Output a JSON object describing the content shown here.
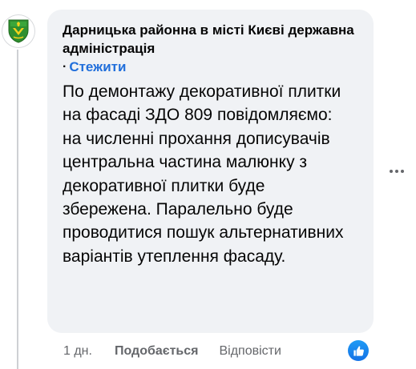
{
  "comment": {
    "author": "Дарницька районна в місті Києві державна адміністрація",
    "follow_dot": "·",
    "follow_label": "Стежити",
    "text": "По демонтажу декоративної плитки на фасаді ЗДО 809 повідомляємо: на численні прохання дописувачів центральна частина малюнку з декоративної плитки буде збережена. Паралельно буде проводитися пошук альтернативних варіантів утеплення фасаду."
  },
  "actions": {
    "time": "1 дн.",
    "like_label": "Подобається",
    "reply_label": "Відповісти"
  },
  "icons": {
    "avatar": "coat-of-arms-icon",
    "more": "more-options-icon",
    "reaction": "like-reaction-icon"
  },
  "colors": {
    "bubble_bg": "#f0f2f5",
    "link": "#216fdb",
    "secondary_text": "#65676b",
    "like_blue": "#1877f2"
  }
}
